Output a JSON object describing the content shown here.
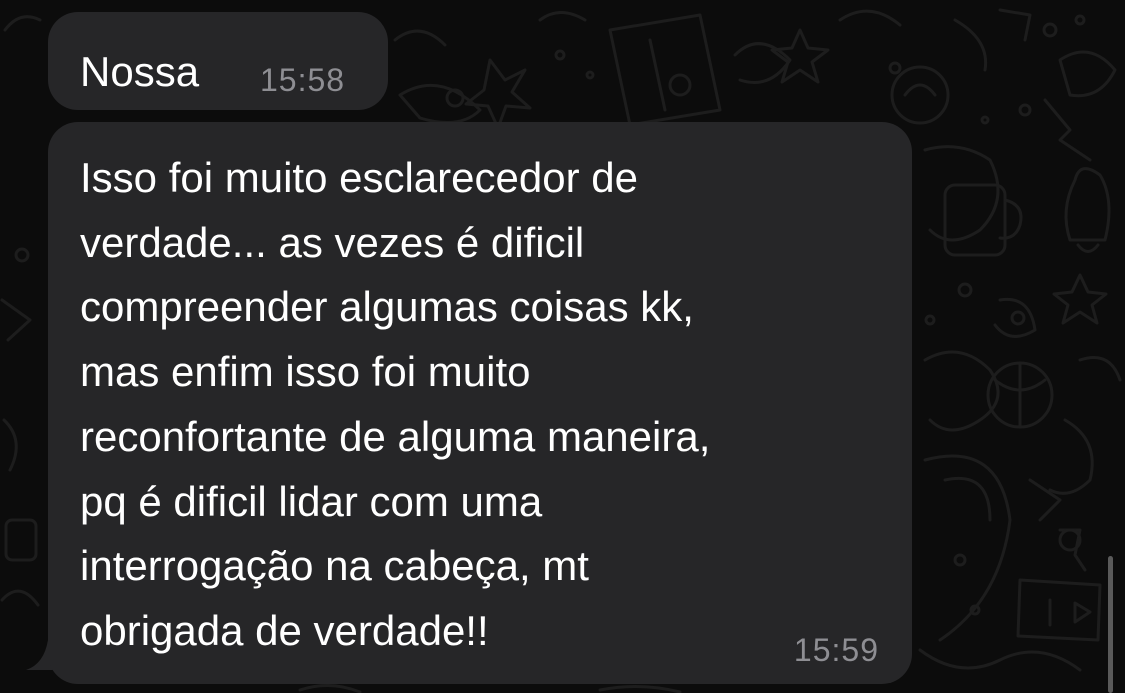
{
  "messages": [
    {
      "text": "Nossa",
      "time": "15:58"
    },
    {
      "text": "Isso foi muito esclarecedor de\nverdade... as vezes é dificil\ncompreender algumas coisas kk,\nmas enfim isso foi muito\nreconfortante de alguma maneira,\npq é dificil lidar com uma\ninterrogação na cabeça, mt\nobrigada de verdade!!",
      "time": "15:59"
    }
  ],
  "theme": {
    "background": "#0c0c0c",
    "bubble": "#262628",
    "text": "#ffffff",
    "timestamp": "#8e8e93"
  }
}
